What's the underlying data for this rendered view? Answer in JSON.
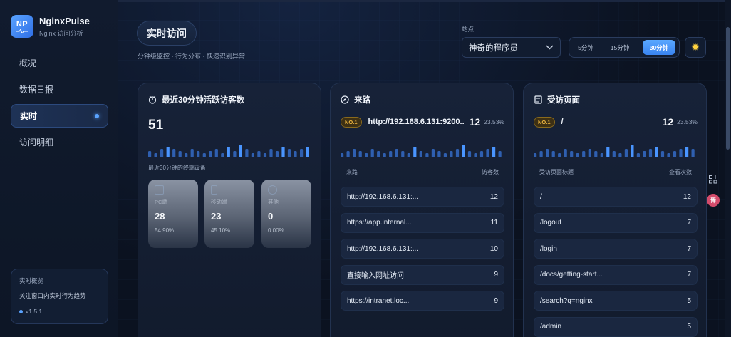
{
  "app": {
    "logo_text": "NP",
    "name": "NginxPulse",
    "subtitle": "Nginx 访问分析"
  },
  "sidebar": {
    "items": [
      {
        "label": "概况",
        "active": false
      },
      {
        "label": "数据日报",
        "active": false
      },
      {
        "label": "实时",
        "active": true
      },
      {
        "label": "访问明细",
        "active": false
      }
    ],
    "footer_card": {
      "title": "实时概览",
      "description": "关注窗口内实时行为趋势",
      "version": "v1.5.1"
    }
  },
  "header": {
    "title": "实时访问",
    "subtitle": "分钟级监控 · 行为分布 · 快速识别异常",
    "site_label": "站点",
    "site_value": "神奇的程序员",
    "ranges": [
      {
        "label": "5分钟",
        "active": false
      },
      {
        "label": "15分钟",
        "active": false
      },
      {
        "label": "30分钟",
        "active": true
      }
    ],
    "theme_icon": "sun-icon"
  },
  "visitors_card": {
    "title": "最近30分钟活跃访客数",
    "count": "51",
    "devices_label": "最近30分钟的终端设备",
    "devices": [
      {
        "name": "PC端",
        "count": "28",
        "percent": "54.90%"
      },
      {
        "name": "移动端",
        "count": "23",
        "percent": "45.10%"
      },
      {
        "name": "其他",
        "count": "0",
        "percent": "0.00%"
      }
    ]
  },
  "referrer_card": {
    "title": "来路",
    "top_badge": "NO.1",
    "top_name": "http://192.168.6.131:9200...",
    "top_count": "12",
    "top_percent": "23.53%",
    "col_source": "来路",
    "col_visitors": "访客数",
    "rows": [
      {
        "name": "http://192.168.6.131:...",
        "value": "12"
      },
      {
        "name": "https://app.internal...",
        "value": "11"
      },
      {
        "name": "http://192.168.6.131:...",
        "value": "10"
      },
      {
        "name": "直接输入网址访问",
        "value": "9"
      },
      {
        "name": "https://intranet.loc...",
        "value": "9"
      }
    ]
  },
  "pages_card": {
    "title": "受访页面",
    "top_badge": "NO.1",
    "top_name": "/",
    "top_count": "12",
    "top_percent": "23.53%",
    "col_page": "受访页面标题",
    "col_views": "查看次数",
    "rows": [
      {
        "name": "/",
        "value": "12"
      },
      {
        "name": "/logout",
        "value": "7"
      },
      {
        "name": "/login",
        "value": "7"
      },
      {
        "name": "/docs/getting-start...",
        "value": "7"
      },
      {
        "name": "/search?q=nginx",
        "value": "5"
      },
      {
        "name": "/admin",
        "value": "5"
      }
    ]
  },
  "float_tools": {
    "avatar_text": "译"
  },
  "colors": {
    "accent": "#4a95ff",
    "badge": "#f0b740",
    "background": "#0b1220"
  }
}
